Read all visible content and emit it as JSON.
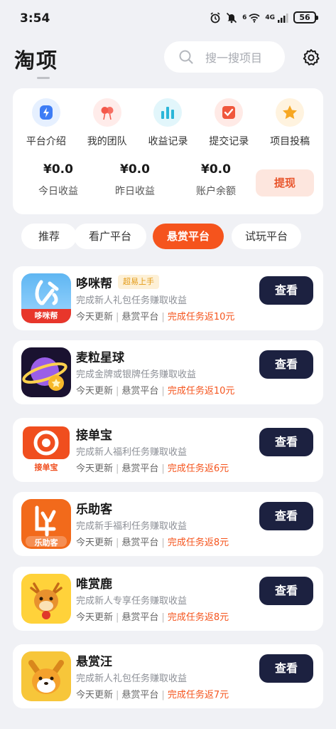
{
  "status_bar": {
    "time": "3:54",
    "network": "4G",
    "wifi_label": "6",
    "battery": "56"
  },
  "header": {
    "title": "淘项",
    "search_placeholder": "搜一搜项目"
  },
  "quick_actions": [
    {
      "label": "平台介绍",
      "icon": "lightning-icon"
    },
    {
      "label": "我的团队",
      "icon": "team-icon"
    },
    {
      "label": "收益记录",
      "icon": "bar-chart-icon"
    },
    {
      "label": "提交记录",
      "icon": "submit-icon"
    },
    {
      "label": "项目投稿",
      "icon": "star-icon"
    }
  ],
  "earnings": [
    {
      "value": "¥0.0",
      "label": "今日收益"
    },
    {
      "value": "¥0.0",
      "label": "昨日收益"
    },
    {
      "value": "¥0.0",
      "label": "账户余额"
    }
  ],
  "withdraw_label": "提现",
  "tabs": [
    {
      "label": "推荐",
      "active": false
    },
    {
      "label": "看广平台",
      "active": false
    },
    {
      "label": "悬赏平台",
      "active": true
    },
    {
      "label": "试玩平台",
      "active": false
    }
  ],
  "items": [
    {
      "name": "哆咪帮",
      "badge": "超易上手",
      "desc": "完成新人礼包任务赚取收益",
      "updated": "今天更新",
      "platform": "悬赏平台",
      "reward": "完成任务返10元",
      "button": "查看",
      "logo_text": "哆咪帮"
    },
    {
      "name": "麦粒星球",
      "badge": "",
      "desc": "完成金牌或银牌任务赚取收益",
      "updated": "今天更新",
      "platform": "悬赏平台",
      "reward": "完成任务返10元",
      "button": "查看",
      "logo_text": ""
    },
    {
      "name": "接单宝",
      "badge": "",
      "desc": "完成新人福利任务赚取收益",
      "updated": "今天更新",
      "platform": "悬赏平台",
      "reward": "完成任务返6元",
      "button": "查看",
      "logo_text": "接单宝"
    },
    {
      "name": "乐助客",
      "badge": "",
      "desc": "完成新手福利任务赚取收益",
      "updated": "今天更新",
      "platform": "悬赏平台",
      "reward": "完成任务返8元",
      "button": "查看",
      "logo_text": "乐助客"
    },
    {
      "name": "唯赏鹿",
      "badge": "",
      "desc": "完成新人专享任务赚取收益",
      "updated": "今天更新",
      "platform": "悬赏平台",
      "reward": "完成任务返8元",
      "button": "查看",
      "logo_text": ""
    },
    {
      "name": "悬赏汪",
      "badge": "",
      "desc": "完成新人礼包任务赚取收益",
      "updated": "今天更新",
      "platform": "悬赏平台",
      "reward": "完成任务返7元",
      "button": "查看",
      "logo_text": ""
    }
  ],
  "colors": {
    "accent": "#f5541d",
    "button_dark": "#1c2140",
    "badge_bg": "#fdf0d6",
    "badge_text": "#e39a16"
  }
}
